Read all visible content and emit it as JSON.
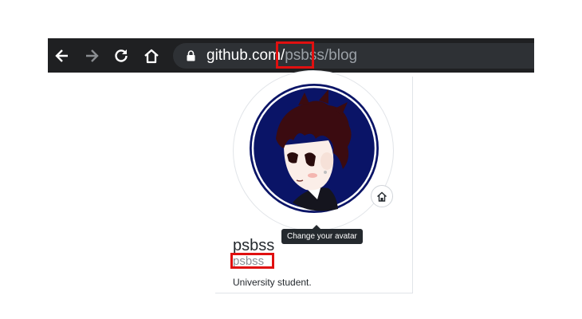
{
  "browser": {
    "url_host": "github.com/",
    "url_path": "psbss",
    "url_tail": "/blog",
    "icons": {
      "back": "arrow-left-icon",
      "forward": "arrow-right-icon",
      "reload": "reload-icon",
      "home": "home-icon",
      "secure": "lock-icon"
    }
  },
  "profile": {
    "fullname": "psbss",
    "username": "psbss",
    "bio": "University student.",
    "avatar_tooltip": "Change your avatar",
    "avatar_edit_icon": "home-icon"
  },
  "colors": {
    "highlight": "#e01010",
    "toolbar": "#1f2022",
    "avatar_bg": "#0a1467"
  }
}
